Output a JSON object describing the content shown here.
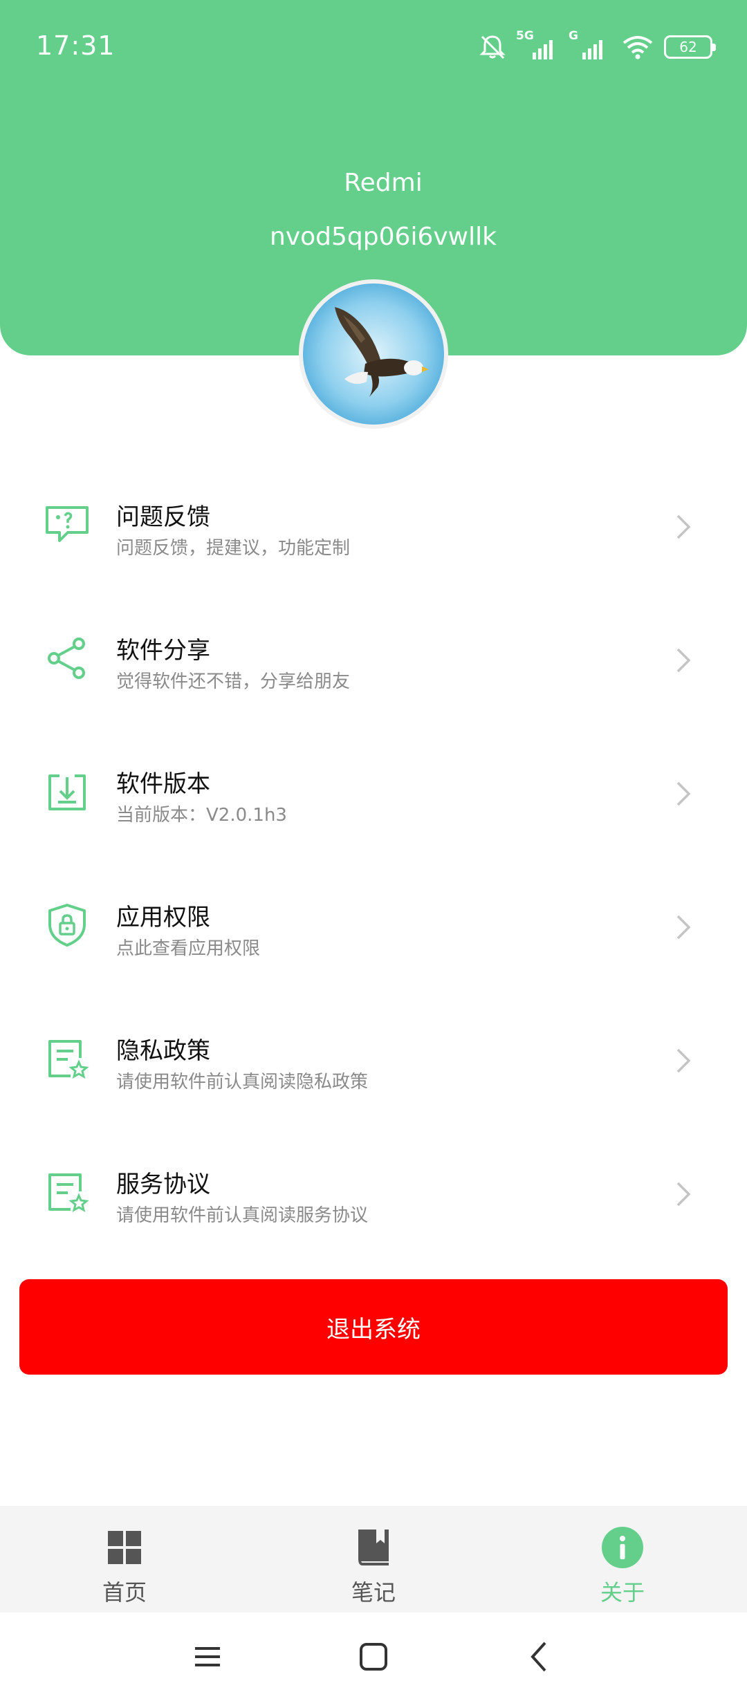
{
  "status_bar": {
    "time": "17:31",
    "network_1": "5G",
    "network_2": "G",
    "battery": "62",
    "icons": [
      "notifications-off-icon",
      "signal-icon",
      "signal-icon",
      "wifi-icon",
      "battery-icon"
    ]
  },
  "profile": {
    "name": "Redmi",
    "id": "nvod5qp06i6vwllk",
    "avatar_icon": "eagle-avatar"
  },
  "menu": [
    {
      "title": "问题反馈",
      "subtitle": "问题反馈，提建议，功能定制",
      "icon": "feedback-icon"
    },
    {
      "title": "软件分享",
      "subtitle": "觉得软件还不错，分享给朋友",
      "icon": "share-icon"
    },
    {
      "title": "软件版本",
      "subtitle": "当前版本：V2.0.1h3",
      "icon": "download-icon"
    },
    {
      "title": "应用权限",
      "subtitle": "点此查看应用权限",
      "icon": "shield-lock-icon"
    },
    {
      "title": "隐私政策",
      "subtitle": "请使用软件前认真阅读隐私政策",
      "icon": "document-star-icon"
    },
    {
      "title": "服务协议",
      "subtitle": "请使用软件前认真阅读服务协议",
      "icon": "document-star-icon"
    }
  ],
  "logout_label": "退出系统",
  "tabs": [
    {
      "label": "首页",
      "icon": "grid-icon",
      "active": false
    },
    {
      "label": "笔记",
      "icon": "notebook-icon",
      "active": false
    },
    {
      "label": "关于",
      "icon": "info-icon",
      "active": true
    }
  ],
  "colors": {
    "accent": "#63cf8a",
    "logout": "#ff0000",
    "tab_inactive": "#555555"
  }
}
